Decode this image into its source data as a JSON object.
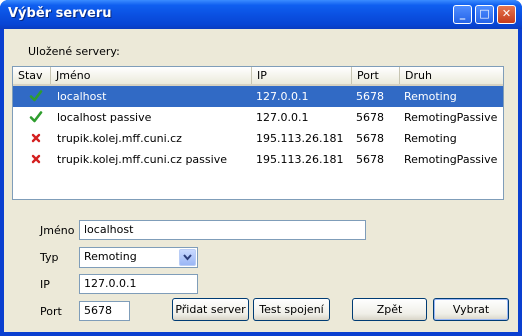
{
  "window": {
    "title": "Výběr serveru",
    "minimize_glyph": "_",
    "maximize_glyph": "□",
    "close_glyph": "✕"
  },
  "servers_label": "Uložené servery:",
  "list": {
    "columns": [
      "Stav",
      "Jméno",
      "IP",
      "Port",
      "Druh"
    ],
    "rows": [
      {
        "status": "check-icon",
        "name": "localhost",
        "ip": "127.0.0.1",
        "port": "5678",
        "kind": "Remoting",
        "selected": true
      },
      {
        "status": "check-icon",
        "name": "localhost passive",
        "ip": "127.0.0.1",
        "port": "5678",
        "kind": "RemotingPassive",
        "selected": false
      },
      {
        "status": "x-icon",
        "name": "trupik.kolej.mff.cuni.cz",
        "ip": "195.113.26.181",
        "port": "5678",
        "kind": "Remoting",
        "selected": false
      },
      {
        "status": "x-icon",
        "name": "trupik.kolej.mff.cuni.cz passive",
        "ip": "195.113.26.181",
        "port": "5678",
        "kind": "RemotingPassive",
        "selected": false
      }
    ]
  },
  "form": {
    "name_label": "Jméno",
    "name_value": "localhost",
    "type_label": "Typ",
    "type_value": "Remoting",
    "ip_label": "IP",
    "ip_value": "127.0.0.1",
    "port_label": "Port",
    "port_value": "5678"
  },
  "buttons": {
    "add": "Přidat server",
    "test": "Test spojení",
    "back": "Zpět",
    "select": "Vybrat"
  },
  "colors": {
    "selection": "#316ac5",
    "ok": "#2e9d2e",
    "error": "#d42020"
  }
}
